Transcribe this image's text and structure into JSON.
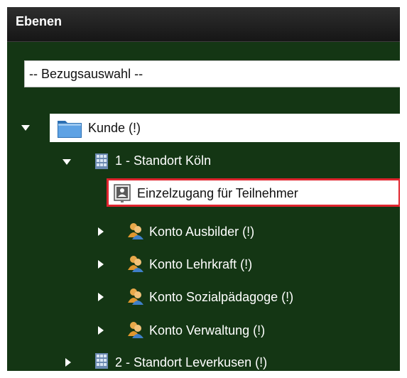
{
  "panel": {
    "title": "Ebenen"
  },
  "select": {
    "value": "-- Bezugsauswahl --"
  },
  "tree": {
    "root": {
      "label": "Kunde (!)",
      "expanded": true,
      "icon": "folder-icon"
    },
    "items": [
      {
        "label": "1 - Standort Köln",
        "expanded": true,
        "icon": "building-icon"
      },
      {
        "label": "Einzelzugang für Teilnehmer",
        "icon": "user-card-icon",
        "selected": true
      },
      {
        "label": "Konto Ausbilder (!)",
        "icon": "users-icon",
        "expanded": false
      },
      {
        "label": "Konto Lehrkraft (!)",
        "icon": "users-icon",
        "expanded": false
      },
      {
        "label": "Konto Sozialpädagoge (!)",
        "icon": "users-icon",
        "expanded": false
      },
      {
        "label": "Konto Verwaltung (!)",
        "icon": "users-icon",
        "expanded": false
      },
      {
        "label": "2 - Standort Leverkusen (!)",
        "icon": "building-icon",
        "expanded": false
      }
    ]
  },
  "colors": {
    "panel_bg": "#143614",
    "highlight_border": "#e0242e"
  }
}
